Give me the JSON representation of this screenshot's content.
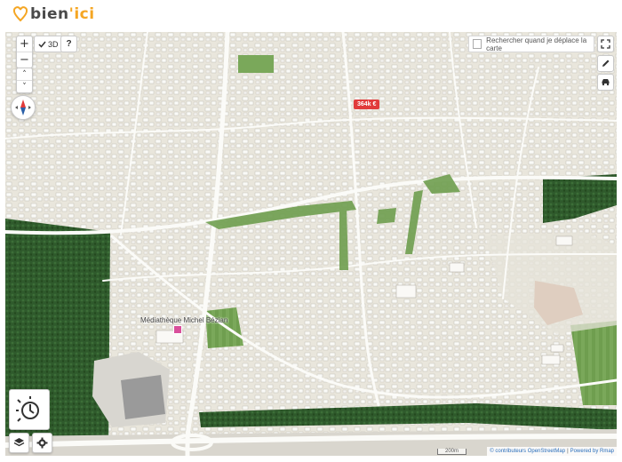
{
  "app": {
    "logo_text_a": "bien",
    "logo_text_b": "'ici"
  },
  "map_controls": {
    "zoom_in": "+",
    "zoom_out": "−",
    "tilt_up": "˄",
    "tilt_down": "˅",
    "btn_3d": "3D",
    "help": "?"
  },
  "search_on_move": {
    "label": "Rechercher quand je déplace la carte"
  },
  "listing": {
    "price": "364k €"
  },
  "poi": {
    "label": "Médiathèque Michel Bézian"
  },
  "attribution": {
    "osm": "© contributeurs OpenStreetMap",
    "separator": "|",
    "powered": "Powered by Rmap"
  },
  "scale": {
    "label": "200m"
  },
  "colors": {
    "accent_orange": "#f5a623",
    "price_red": "#e13b3b",
    "forest": "#2f5a2c",
    "ground": "#e9e6dc",
    "sport_field": "#c98f74"
  }
}
